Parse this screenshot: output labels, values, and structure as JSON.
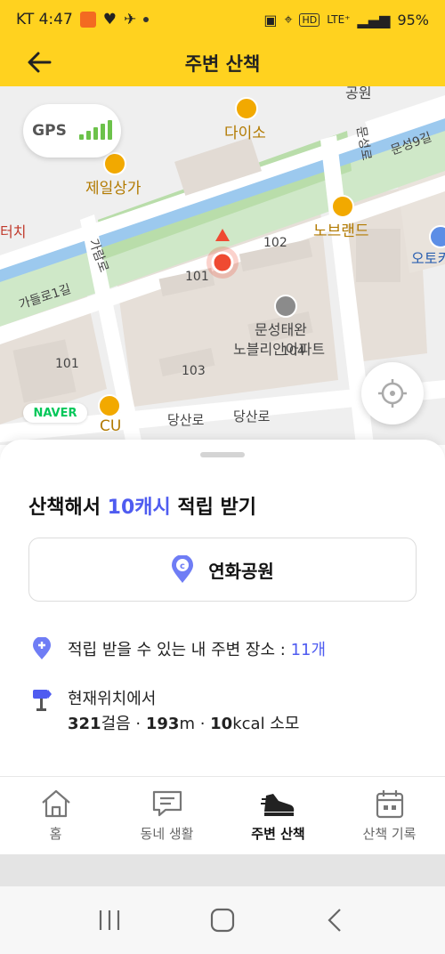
{
  "status_bar": {
    "carrier_time": "KT 4:47",
    "network": "LTE⁺",
    "battery": "95%"
  },
  "app_bar": {
    "title": "주변 산책",
    "back_icon": "arrow-left-icon"
  },
  "map": {
    "gps_label": "GPS",
    "provider": "NAVER",
    "labels": {
      "daiso": "다이소",
      "jeil": "제일상가",
      "touch": "터치",
      "garam": "가람로",
      "garam1": "가들로1길",
      "norebrand": "노브랜드",
      "munseong": "문성로",
      "munseong9": "문성9길",
      "otokey": "오토키",
      "b101": "101",
      "b102": "102",
      "b103": "103",
      "b104": "104",
      "b101_left": "101",
      "apt1": "문성태완",
      "apt2": "노블리안아파트",
      "cu": "CU",
      "dangsan1": "당산로",
      "dangsan2": "당산로",
      "top_cut": "공원"
    }
  },
  "sheet": {
    "headline_prefix": "산책해서",
    "headline_accent": "10캐시",
    "headline_suffix": "적립 받기",
    "place_name": "연화공원",
    "places_text": "적립 받을 수 있는 내 주변 장소 :",
    "places_count": "11개",
    "from_here": "현재위치에서",
    "steps_value": "321",
    "steps_unit": "걸음 · ",
    "distance_value": "193",
    "distance_unit": "m · ",
    "kcal_value": "10",
    "kcal_unit": "kcal 소모"
  },
  "nav": [
    {
      "label": "홈",
      "icon": "home-icon"
    },
    {
      "label": "동네 생활",
      "icon": "chat-icon"
    },
    {
      "label": "주변 산책",
      "icon": "sneaker-icon",
      "active": true
    },
    {
      "label": "산책 기록",
      "icon": "calendar-icon"
    }
  ],
  "colors": {
    "brand_yellow": "#FFD21F",
    "accent_blue": "#4f5cf0",
    "marker_red": "#ef4a32"
  }
}
